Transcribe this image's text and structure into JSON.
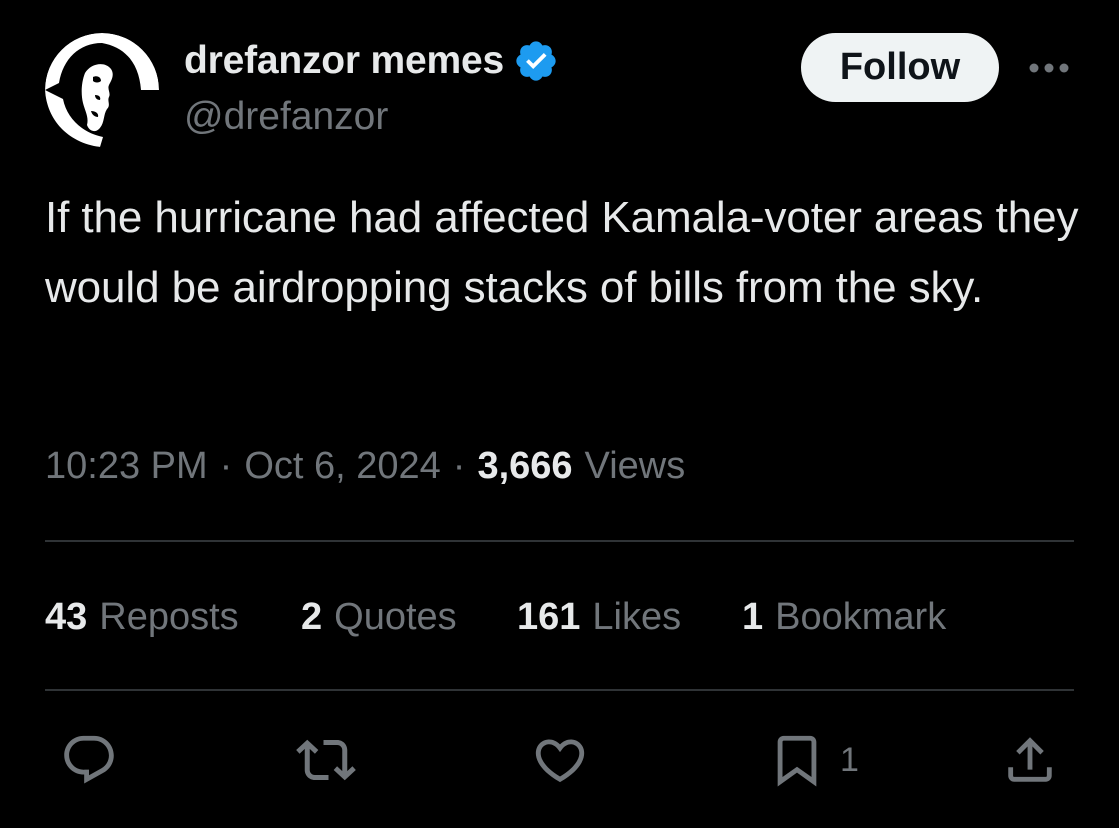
{
  "author": {
    "display_name": "drefanzor memes",
    "handle": "@drefanzor",
    "verified_icon": "verified-badge-icon",
    "avatar_icon": "profile-silhouette"
  },
  "header": {
    "follow_label": "Follow",
    "more_icon": "more-horizontal-icon"
  },
  "tweet": {
    "text": "If the hurricane had affected Kamala-voter areas they would be airdropping stacks of bills from the sky."
  },
  "meta": {
    "time": "10:23 PM",
    "separator": "·",
    "date": "Oct 6, 2024",
    "views_count": "3,666",
    "views_label": "Views"
  },
  "stats": {
    "reposts_count": "43",
    "reposts_label": "Reposts",
    "quotes_count": "2",
    "quotes_label": "Quotes",
    "likes_count": "161",
    "likes_label": "Likes",
    "bookmarks_count": "1",
    "bookmarks_label": "Bookmark"
  },
  "actions": {
    "reply_icon": "reply-icon",
    "repost_icon": "repost-icon",
    "like_icon": "heart-icon",
    "bookmark_icon": "bookmark-icon",
    "bookmark_count": "1",
    "share_icon": "share-icon"
  },
  "colors": {
    "background": "#000000",
    "text_primary": "#e7e9ea",
    "text_secondary": "#71767b",
    "divider": "#2f3336",
    "verified": "#1d9bf0",
    "follow_bg": "#eff3f4"
  }
}
